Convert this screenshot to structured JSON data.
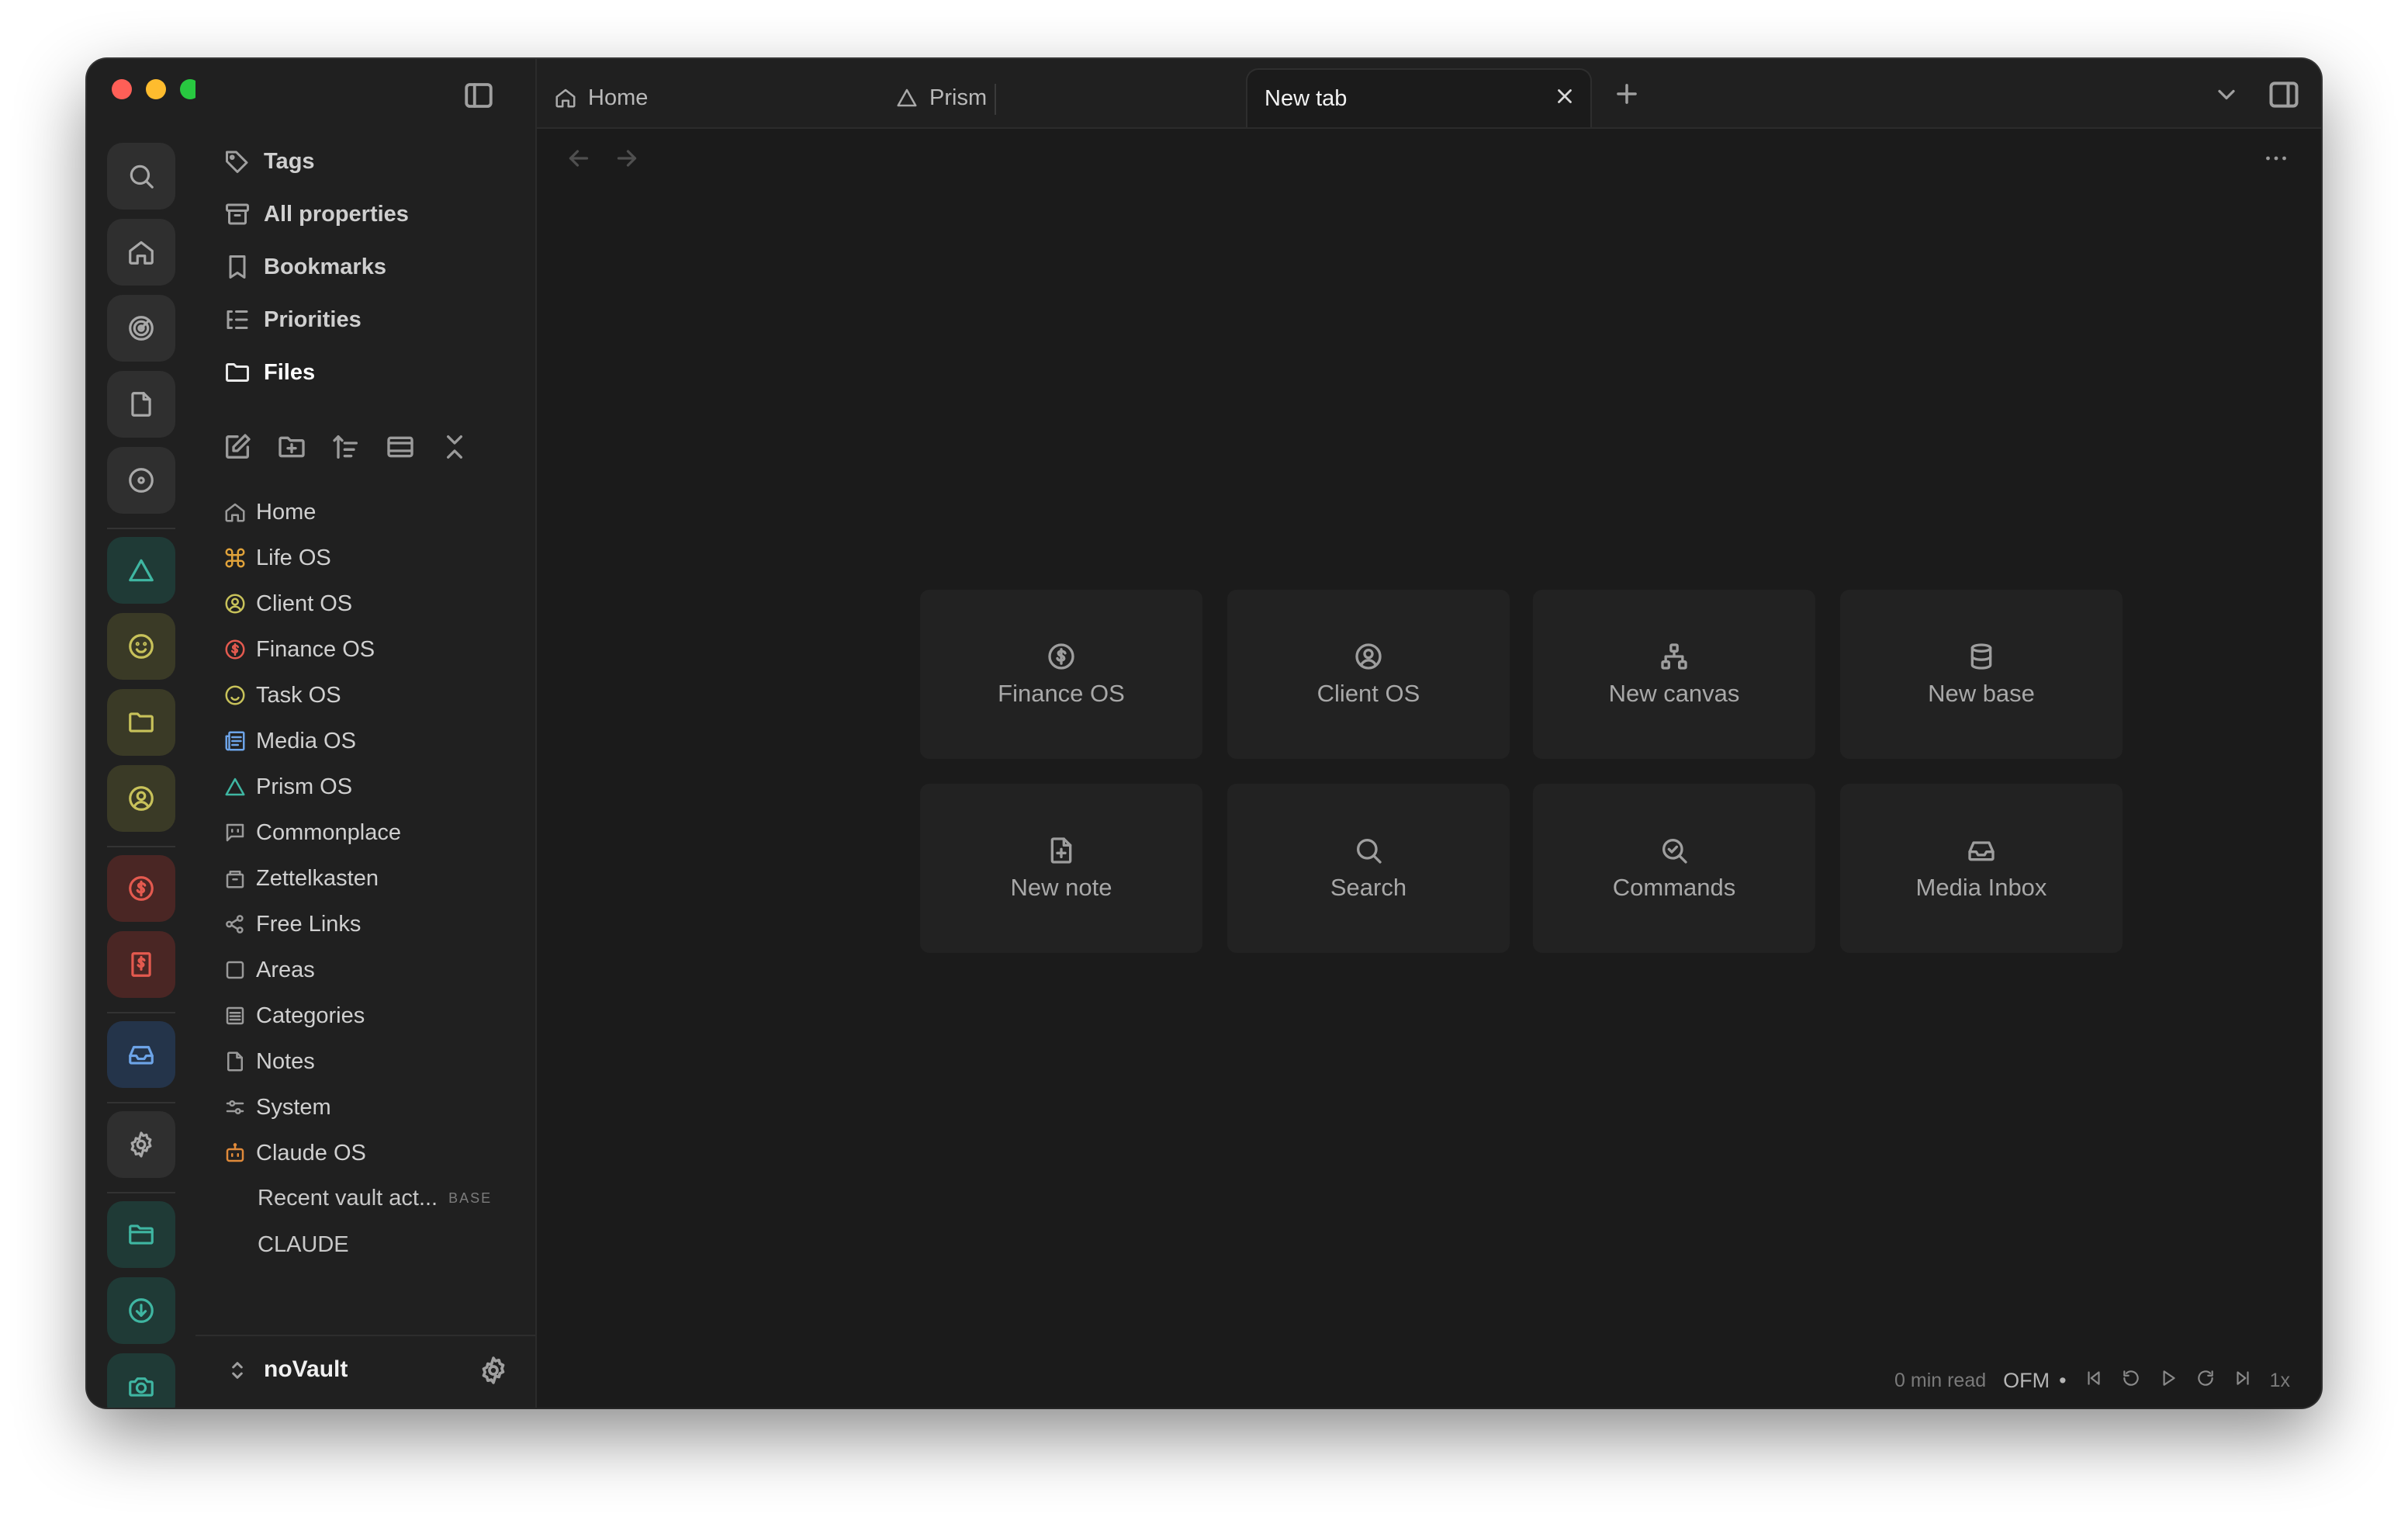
{
  "colors": {
    "close": "#ff5f57",
    "minimize": "#febc2e",
    "maximize": "#28c840",
    "teal": "#3fb6a2",
    "olive": "#c8c25a",
    "red": "#e45a4f",
    "blue": "#6da4e8",
    "orange": "#e08a3a"
  },
  "panel_nav": [
    {
      "label": "Tags",
      "icon": "tag-icon"
    },
    {
      "label": "All properties",
      "icon": "archive-icon"
    },
    {
      "label": "Bookmarks",
      "icon": "bookmark-icon"
    },
    {
      "label": "Priorities",
      "icon": "list-tree-icon"
    },
    {
      "label": "Files",
      "icon": "folder-icon"
    }
  ],
  "file_toolbar": [
    "new-note-icon",
    "new-folder-icon",
    "sort-icon",
    "collapse-view-icon",
    "collapse-all-icon"
  ],
  "tree": [
    {
      "label": "Home",
      "icon": "home-icon",
      "color": "#9a9a9a"
    },
    {
      "label": "Life OS",
      "icon": "command-icon",
      "color": "#e0a23a"
    },
    {
      "label": "Client OS",
      "icon": "user-circle-icon",
      "color": "#c8c25a"
    },
    {
      "label": "Finance OS",
      "icon": "dollar-circle-icon",
      "color": "#e45a4f"
    },
    {
      "label": "Task OS",
      "icon": "smile-icon",
      "color": "#c8c25a"
    },
    {
      "label": "Media OS",
      "icon": "newspaper-icon",
      "color": "#6da4e8"
    },
    {
      "label": "Prism OS",
      "icon": "triangle-icon",
      "color": "#3fb6a2"
    },
    {
      "label": "Commonplace",
      "icon": "message-square-icon",
      "color": "#9a9a9a"
    },
    {
      "label": "Zettelkasten",
      "icon": "drawer-icon",
      "color": "#9a9a9a"
    },
    {
      "label": "Free Links",
      "icon": "share-icon",
      "color": "#9a9a9a"
    },
    {
      "label": "Areas",
      "icon": "square-icon",
      "color": "#9a9a9a"
    },
    {
      "label": "Categories",
      "icon": "list-icon",
      "color": "#9a9a9a"
    },
    {
      "label": "Notes",
      "icon": "file-icon",
      "color": "#9a9a9a"
    },
    {
      "label": "System",
      "icon": "sliders-icon",
      "color": "#9a9a9a"
    },
    {
      "label": "Claude OS",
      "icon": "bot-icon",
      "color": "#e08a3a"
    }
  ],
  "tree_sub": [
    {
      "label": "Recent vault act...",
      "badge": "BASE"
    },
    {
      "label": "CLAUDE",
      "badge": ""
    }
  ],
  "vault": {
    "name": "noVault"
  },
  "tabs": [
    {
      "label": "Home",
      "icon": "home-icon"
    },
    {
      "label": "Prism",
      "icon": "triangle-icon"
    },
    {
      "label": "New tab",
      "icon": ""
    }
  ],
  "cards": [
    {
      "label": "Finance OS",
      "icon": "dollar-circle-icon"
    },
    {
      "label": "Client OS",
      "icon": "user-circle-icon"
    },
    {
      "label": "New canvas",
      "icon": "network-icon"
    },
    {
      "label": "New base",
      "icon": "database-icon"
    },
    {
      "label": "New note",
      "icon": "file-plus-icon"
    },
    {
      "label": "Search",
      "icon": "search-icon"
    },
    {
      "label": "Commands",
      "icon": "search-check-icon"
    },
    {
      "label": "Media Inbox",
      "icon": "inbox-icon"
    }
  ],
  "status": {
    "read_time": "0 min read",
    "format": "OFM",
    "dot": "•",
    "speed": "1x"
  }
}
